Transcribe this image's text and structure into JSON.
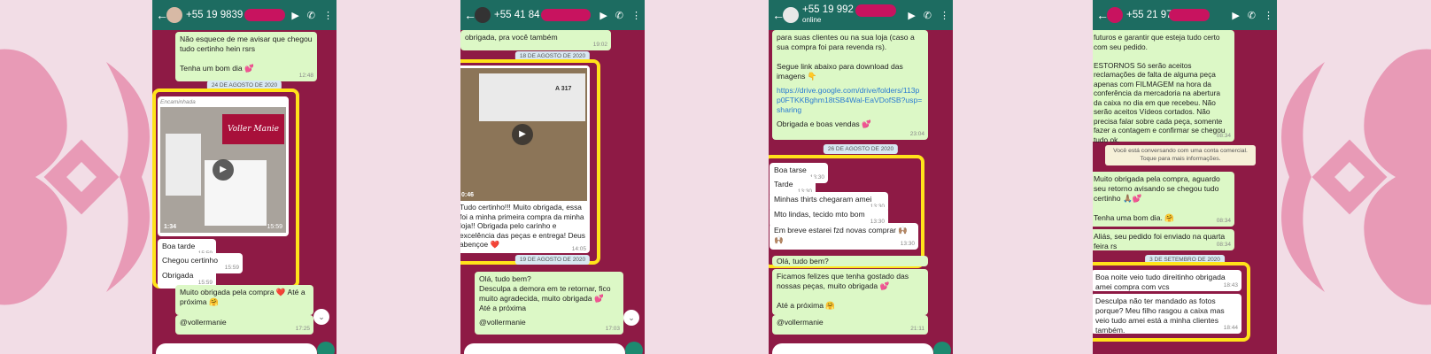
{
  "colors": {
    "accent": "#ffe31a",
    "header": "#1d6c61",
    "outgoing": "#dcf8c6",
    "chat_bg": "#8e1a45",
    "page_bg": "#f2dde6"
  },
  "phone1": {
    "contact": "+55 19 9839",
    "m1": "Não esquece de me avisar que chegou tudo certinho hein rsrs\n\nTenha um bom dia 💕",
    "m1_time": "12:48",
    "date": "24 DE AGOSTO DE 2020",
    "forwarded": "Encaminhada",
    "brand": "Voller Manie",
    "video_duration": "1:34",
    "video_time": "15:59",
    "r1": "Boa tarde",
    "r1_time": "15:59",
    "r2": "Chegou certinho",
    "r2_time": "15:59",
    "r3": "Obrigada",
    "r3_time": "15:59",
    "m2": "Muito obrigada pela compra ❤️ Até a próxima 🤗",
    "m3": "@vollermanie",
    "m3_time": "17:25"
  },
  "phone2": {
    "contact": "+55 41 84",
    "m0": "obrigada, pra você também",
    "m0_time": "19:02",
    "date1": "18 DE AGOSTO DE 2020",
    "video_duration": "0:46",
    "label_text": "A 317",
    "caption": "Tudo certinho!!! Muito obrigada, essa foi a minha primeira compra da minha loja!! Obrigada pelo carinho e excelência das peças e entrega! Deus abençoe ❤️",
    "caption_time": "14:05",
    "date2": "19 DE AGOSTO DE 2020",
    "m1": "Olá, tudo bem?\nDesculpa a demora em te retornar, fico muito agradecida, muito obrigada 💕\nAté a próxima",
    "m2": "@vollermanie",
    "m2_time": "17:03"
  },
  "phone3": {
    "contact": "+55 19 992",
    "status": "online",
    "m1": "para suas clientes ou na sua loja (caso a sua compra foi para revenda rs).\n\nSegue link abaixo para download das imagens 👇",
    "link": "https://drive.google.com/drive/folders/113pp0FTKKBghm18tSB4Wal-EaVDofSB?usp=sharing",
    "m1b": "Obrigada e boas vendas 💕",
    "m1_time": "23:04",
    "date": "26 DE AGOSTO DE 2020",
    "r1": "Boa tarse",
    "r1_time": "13:30",
    "r2": "Tarde",
    "r2_time": "13:30",
    "r3": "Minhas thirts chegaram amei",
    "r3_time": "13:30",
    "r4": "Mto lindas, tecido mto bom",
    "r4_time": "13:30",
    "r5": "Em breve estarei fzd novas comprar 🙌🏽🙌🏽",
    "r5_time": "13:30",
    "m2": "Olá, tudo bem?",
    "m3": "Ficamos felizes que tenha gostado das nossas peças, muito obrigada 💕\n\nAté a próxima 🤗",
    "m4": "@vollermanie",
    "m4_time": "21:11"
  },
  "phone4": {
    "contact": "+55 21 970",
    "m1": "futuros e garantir que esteja tudo certo com seu pedido.\n\nESTORNOS  Só serão aceitos reclamações de falta de alguma peça apenas com FILMAGEM na hora da conferência da mercadoria na abertura da caixa no dia em que recebeu. Não serão aceitos Vídeos cortados. Não precisa falar sobre cada peça, somente fazer a contagem e confirmar se chegou tudo ok.",
    "m1_time": "08:34",
    "sys": "Você está conversando com uma conta comercial. Toque para mais informações.",
    "m2": "Muito obrigada pela compra, aguardo seu retorno avisando se chegou tudo certinho 🙏🏽💕\n\nTenha uma bom dia. 🤗",
    "m2_time": "08:34",
    "m3": "Aliás, seu pedido foi enviado na quarta feira rs",
    "m3_time": "08:34",
    "date": "3 DE SETEMBRO DE 2020",
    "r1": "Boa noite veio tudo direitinho obrigada amei compra com vcs",
    "r1_time": "18:43",
    "r2": "Desculpa não ter mandado as fotos porque? Meu filho rasgou a caixa mas veio tudo amei está a minha clientes também.",
    "r2_time": "18:44"
  }
}
